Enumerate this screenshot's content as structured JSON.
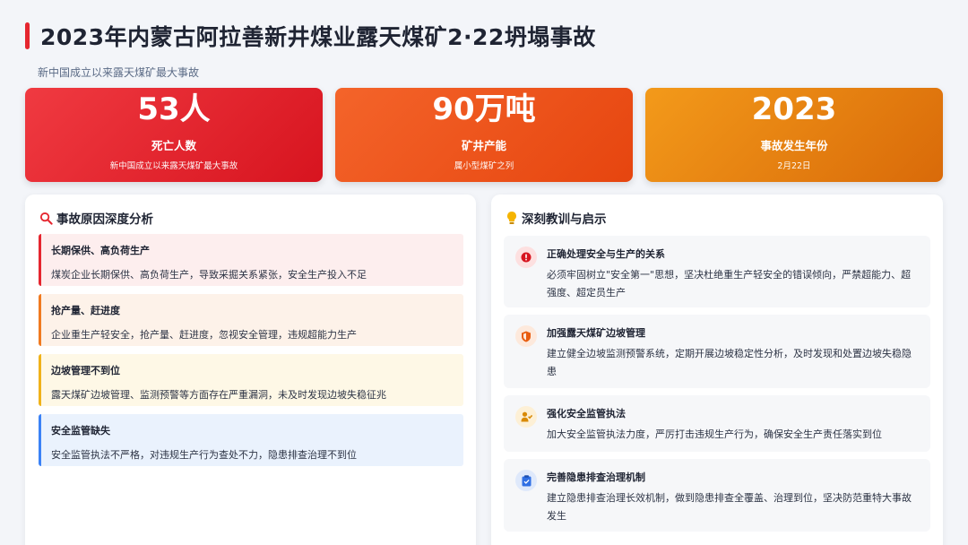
{
  "header": {
    "title": "2023年内蒙古阿拉善新井煤业露天煤矿2·22坍塌事故",
    "subtitle": "新中国成立以来露天煤矿最大事故"
  },
  "stats": [
    {
      "value": "53人",
      "label": "死亡人数",
      "sub": "新中国成立以来露天煤矿最大事故"
    },
    {
      "value": "90万吨",
      "label": "矿井产能",
      "sub": "属小型煤矿之列"
    },
    {
      "value": "2023",
      "label": "事故发生年份",
      "sub": "2月22日"
    }
  ],
  "causes_panel": {
    "title": "事故原因深度分析",
    "icon": "magnifier-icon",
    "items": [
      {
        "heading": "长期保供、高负荷生产",
        "desc": "煤炭企业长期保供、高负荷生产，导致采掘关系紧张，安全生产投入不足"
      },
      {
        "heading": "抢产量、赶进度",
        "desc": "企业重生产轻安全，抢产量、赶进度，忽视安全管理，违规超能力生产"
      },
      {
        "heading": "边坡管理不到位",
        "desc": "露天煤矿边坡管理、监测预警等方面存在严重漏洞，未及时发现边坡失稳征兆"
      },
      {
        "heading": "安全监管缺失",
        "desc": "安全监管执法不严格，对违规生产行为查处不力，隐患排查治理不到位"
      }
    ]
  },
  "lessons_panel": {
    "title": "深刻教训与启示",
    "icon": "lightbulb-icon",
    "items": [
      {
        "heading": "正确处理安全与生产的关系",
        "desc": "必须牢固树立\"安全第一\"思想，坚决杜绝重生产轻安全的错误倾向，严禁超能力、超强度、超定员生产",
        "icon": "alert-icon"
      },
      {
        "heading": "加强露天煤矿边坡管理",
        "desc": "建立健全边坡监测预警系统，定期开展边坡稳定性分析，及时发现和处置边坡失稳隐患",
        "icon": "shield-icon"
      },
      {
        "heading": "强化安全监管执法",
        "desc": "加大安全监管执法力度，严厉打击违规生产行为，确保安全生产责任落实到位",
        "icon": "inspector-icon"
      },
      {
        "heading": "完善隐患排查治理机制",
        "desc": "建立隐患排查治理长效机制，做到隐患排查全覆盖、治理到位，坚决防范重特大事故发生",
        "icon": "clipboard-icon"
      }
    ]
  },
  "colors": {
    "accent_red": "#e5262f",
    "accent_orange": "#f07a20",
    "accent_yellow": "#f0b21a",
    "accent_blue": "#3b82f6"
  }
}
